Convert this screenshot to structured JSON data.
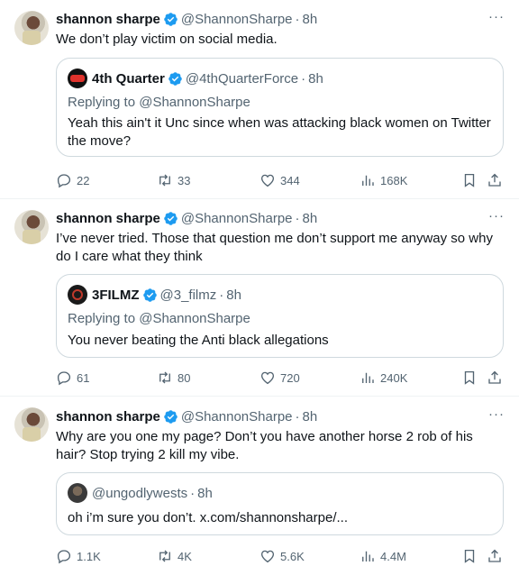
{
  "tweets": [
    {
      "author": "shannon sharpe",
      "handle": "@ShannonSharpe",
      "dot": "·",
      "time": "8h",
      "more": "···",
      "text": "We don’t play victim on social media.",
      "quote": {
        "author": "4th Quarter",
        "handle": "@4thQuarterForce",
        "dot": "·",
        "time": "8h",
        "replying": "Replying to @ShannonSharpe",
        "text": "Yeah this ain't it Unc since when was attacking black women on Twitter the move?"
      },
      "stats": {
        "replies": "22",
        "retweets": "33",
        "likes": "344",
        "views": "168K"
      }
    },
    {
      "author": "shannon sharpe",
      "handle": "@ShannonSharpe",
      "dot": "·",
      "time": "8h",
      "more": "···",
      "text": "I’ve never tried. Those that question me don’t support me anyway so why do I care what they think",
      "quote": {
        "author": "3FILMZ",
        "handle": "@3_filmz",
        "dot": "·",
        "time": "8h",
        "replying": "Replying to @ShannonSharpe",
        "text": "You never beating the Anti black allegations"
      },
      "stats": {
        "replies": "61",
        "retweets": "80",
        "likes": "720",
        "views": "240K"
      }
    },
    {
      "author": "shannon sharpe",
      "handle": "@ShannonSharpe",
      "dot": "·",
      "time": "8h",
      "more": "···",
      "text": "Why are you one my page? Don’t you have another horse 2 rob of his hair? Stop trying 2 kill my vibe.",
      "quote": {
        "handle": "@ungodlywests",
        "dot": "·",
        "time": "8h",
        "text": "oh i’m sure you don’t. x.com/shannonsharpe/..."
      },
      "stats": {
        "replies": "1.1K",
        "retweets": "4K",
        "likes": "5.6K",
        "views": "4.4M"
      }
    }
  ],
  "colors": {
    "verified": "#1d9bf0",
    "muted": "#536471",
    "border": "#cfd9de",
    "text": "#0f1419"
  },
  "icons": [
    "reply-icon",
    "retweet-icon",
    "like-icon",
    "views-icon",
    "bookmark-icon",
    "share-icon",
    "verified-badge-icon",
    "more-icon"
  ]
}
